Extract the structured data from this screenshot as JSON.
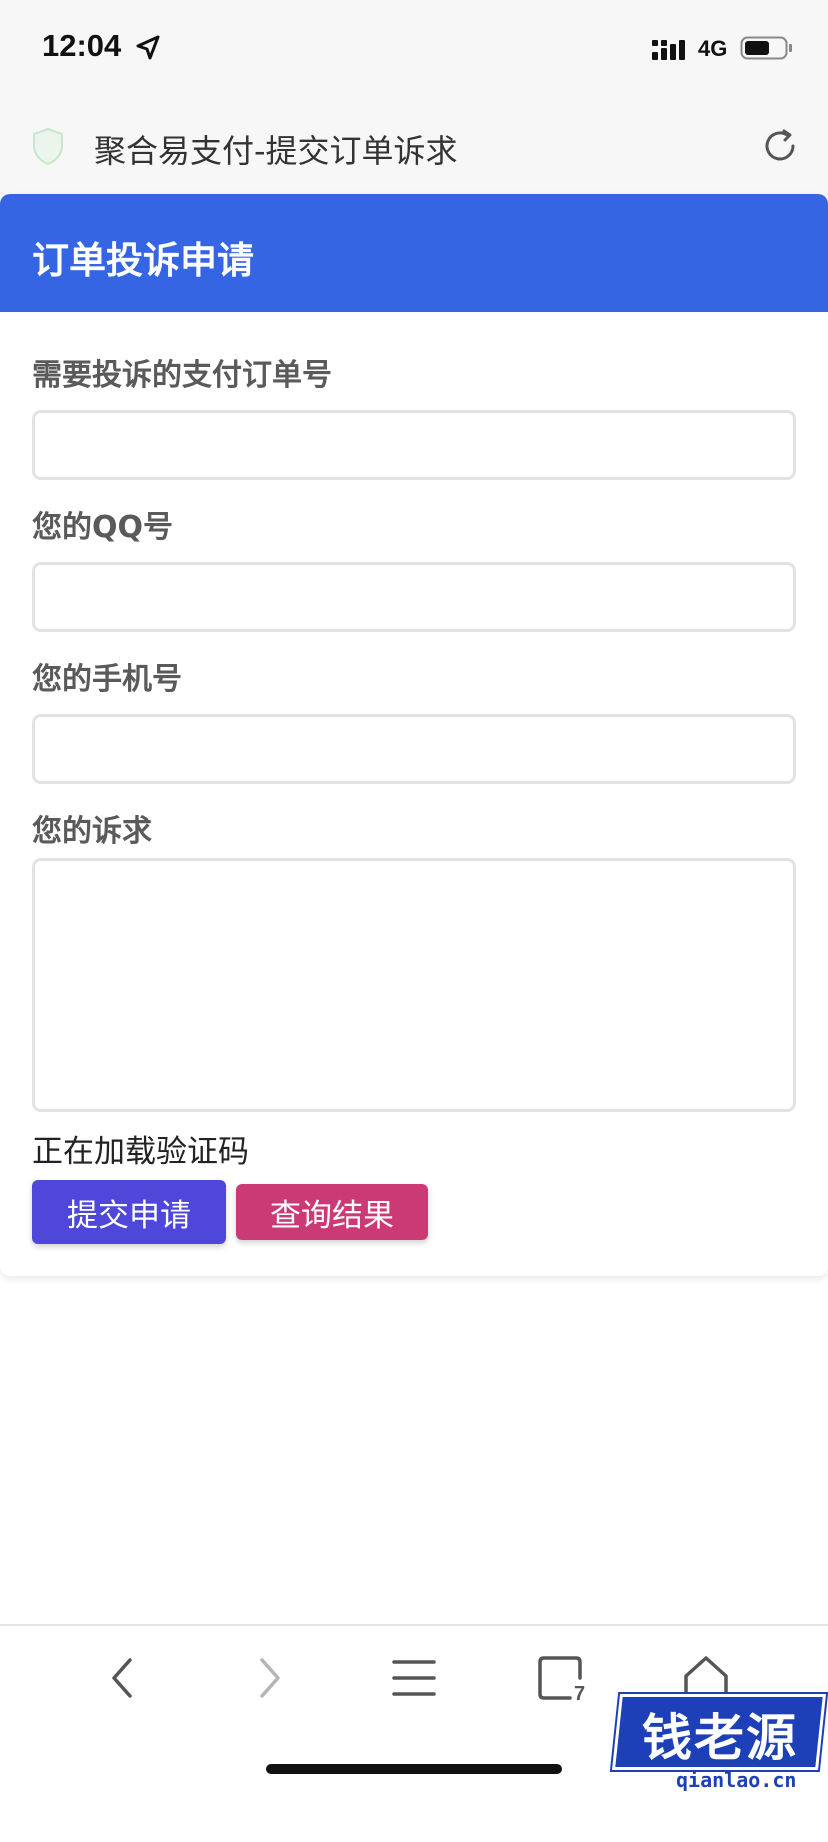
{
  "status_bar": {
    "time": "12:04",
    "network": "4G"
  },
  "browser": {
    "page_title": "聚合易支付-提交订单诉求"
  },
  "form": {
    "heading": "订单投诉申请",
    "fields": [
      {
        "label": "需要投诉的支付订单号",
        "value": ""
      },
      {
        "label": "您的QQ号",
        "value": ""
      },
      {
        "label": "您的手机号",
        "value": ""
      },
      {
        "label": "您的诉求",
        "value": ""
      }
    ],
    "captcha_status": "正在加载验证码",
    "submit_label": "提交申请",
    "query_label": "查询结果"
  },
  "toolbar": {
    "icons": [
      "back-icon",
      "forward-icon",
      "menu-icon",
      "tabs-icon",
      "home-icon"
    ],
    "tabs_count": "7"
  },
  "watermark": {
    "title": "钱老源码",
    "domain": "qianlao.cn"
  },
  "colors": {
    "header": "#3565e3",
    "submit_button": "#4f47d9",
    "query_button": "#cc3a76"
  }
}
